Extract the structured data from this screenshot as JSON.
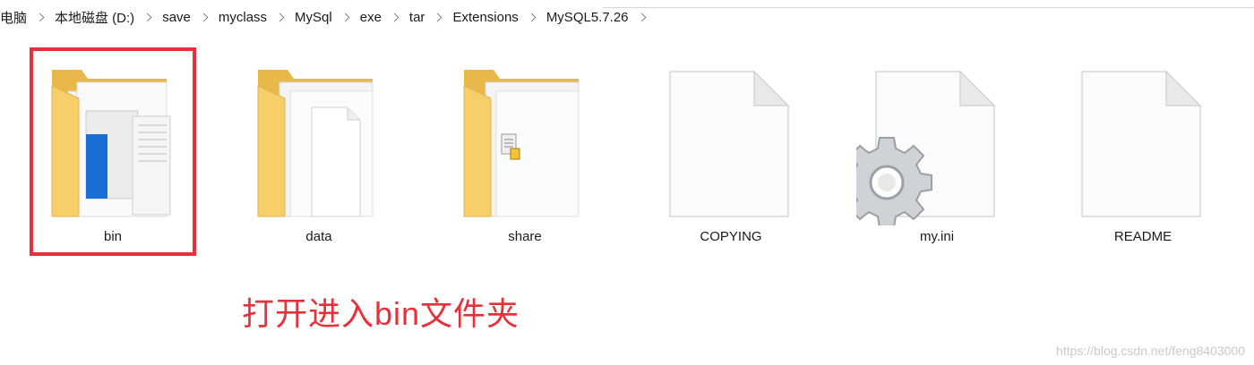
{
  "breadcrumb": [
    "电脑",
    "本地磁盘 (D:)",
    "save",
    "myclass",
    "MySql",
    "exe",
    "tar",
    "Extensions",
    "MySQL5.7.26"
  ],
  "items": [
    {
      "name": "bin",
      "type": "folder-icon"
    },
    {
      "name": "data",
      "type": "folder-icon"
    },
    {
      "name": "share",
      "type": "folder-icon"
    },
    {
      "name": "COPYING",
      "type": "file-icon"
    },
    {
      "name": "my.ini",
      "type": "settings-file-icon"
    },
    {
      "name": "README",
      "type": "file-icon"
    }
  ],
  "annotation": "打开进入bin文件夹",
  "watermark": "https://blog.csdn.net/feng8403000",
  "colors": {
    "highlight": "#e8303a",
    "folder": "#f7cf6a"
  }
}
